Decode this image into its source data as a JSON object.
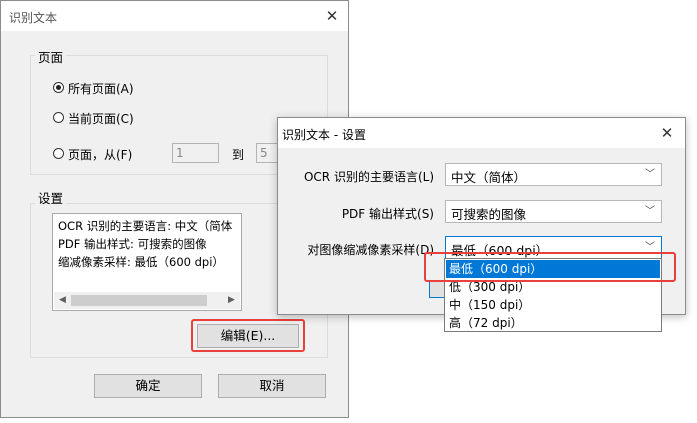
{
  "main_dialog": {
    "title": "识别文本",
    "close_icon": "✕",
    "pages_group": {
      "label": "页面",
      "options": [
        "所有页面(A)",
        "当前页面(C)",
        "页面，从(F)"
      ],
      "selected": 0,
      "from_value": "1",
      "to_label": "到",
      "to_value": "5"
    },
    "settings_group": {
      "label": "设置",
      "summary_lines": [
        "OCR 识别的主要语言: 中文（简体",
        "PDF 输出样式: 可搜索的图像",
        "缩减像素采样: 最低（600 dpi）"
      ],
      "edit_button": "编辑(E)..."
    },
    "ok_button": "确定",
    "cancel_button": "取消"
  },
  "settings_dialog": {
    "title": "识别文本 - 设置",
    "close_icon": "✕",
    "fields": [
      {
        "label": "OCR 识别的主要语言(L)",
        "value": "中文（简体）"
      },
      {
        "label": "PDF 输出样式(S)",
        "value": "可搜索的图像"
      },
      {
        "label": "对图像缩减像素采样(D)",
        "value": "最低（600 dpi）"
      }
    ],
    "dropdown_options": [
      "最低（600 dpi）",
      "低（300 dpi）",
      "中（150 dpi）",
      "高（72 dpi）"
    ],
    "dropdown_selected": 0
  },
  "colors": {
    "highlight": "#0078d7",
    "annotation_red": "#e8413b"
  }
}
